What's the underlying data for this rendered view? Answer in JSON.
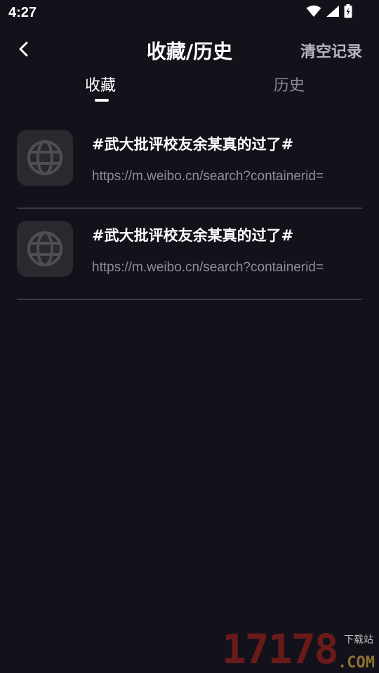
{
  "status_bar": {
    "time": "4:27"
  },
  "header": {
    "title": "收藏/历史",
    "clear_label": "清空记录"
  },
  "tabs": [
    {
      "label": "收藏",
      "active": true
    },
    {
      "label": "历史",
      "active": false
    }
  ],
  "items": [
    {
      "title": "#武大批评校友余某真的过了#",
      "url": "https://m.weibo.cn/search?containerid="
    },
    {
      "title": "#武大批评校友余某真的过了#",
      "url": "https://m.weibo.cn/search?containerid="
    }
  ],
  "watermark": {
    "number": "17178",
    "domain": ".COM",
    "tagline": "下载站"
  },
  "colors": {
    "background": "#13121b",
    "muted_text": "#8e8d95",
    "divider": "#3a3944",
    "thumb_bg": "#2a2930"
  }
}
